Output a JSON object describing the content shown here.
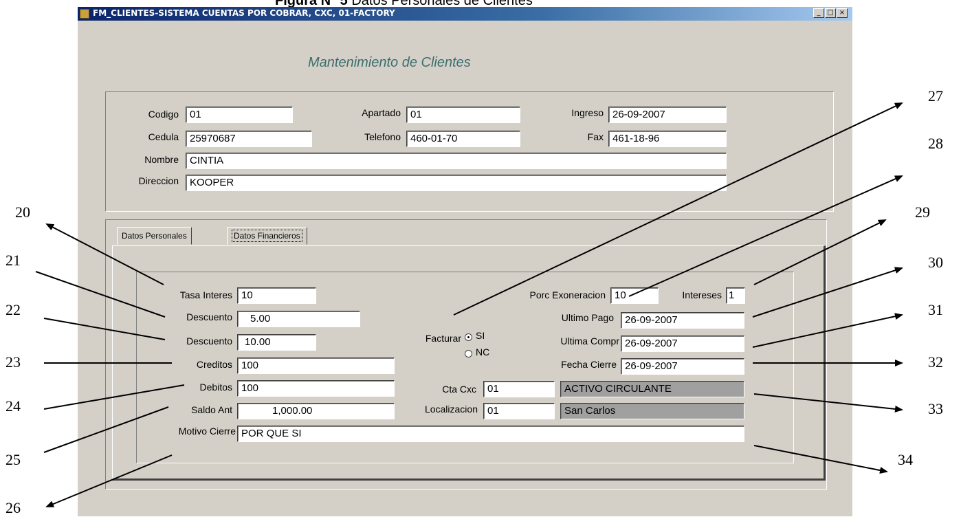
{
  "figure_caption": {
    "bold": "Figura N° 5",
    "rest": " Datos Personales de Clientes"
  },
  "window": {
    "title": "FM_CLIENTES-SISTEMA CUENTAS POR COBRAR, CXC, 01-FACTORY",
    "minimize_glyph": "_",
    "maximize_glyph": "□",
    "close_glyph": "×"
  },
  "form_title": "Mantenimiento de Clientes",
  "header": {
    "codigo": {
      "label": "Codigo",
      "value": "01"
    },
    "apartado": {
      "label": "Apartado",
      "value": "01"
    },
    "ingreso": {
      "label": "Ingreso",
      "value": "26-09-2007"
    },
    "cedula": {
      "label": "Cedula",
      "value": "25970687"
    },
    "telefono": {
      "label": "Telefono",
      "value": "460-01-70"
    },
    "fax": {
      "label": "Fax",
      "value": "461-18-96"
    },
    "nombre": {
      "label": "Nombre",
      "value": "CINTIA"
    },
    "direccion": {
      "label": "Direccion",
      "value": "KOOPER"
    }
  },
  "tabs": [
    {
      "label": "Datos Personales",
      "active": false
    },
    {
      "label": "Datos Financieros",
      "active": true
    }
  ],
  "financial": {
    "tasa_interes": {
      "label": "Tasa Interes",
      "value": "10"
    },
    "descuento1": {
      "label": "Descuento",
      "value": "5.00"
    },
    "descuento2": {
      "label": "Descuento",
      "value": "10.00"
    },
    "creditos": {
      "label": "Creditos",
      "value": "100"
    },
    "debitos": {
      "label": "Debitos",
      "value": "100"
    },
    "saldo_ant": {
      "label": "Saldo Ant",
      "value": "1,000.00"
    },
    "motivo_cierre": {
      "label": "Motivo Cierre",
      "value": "POR QUE SI"
    },
    "facturar": {
      "label": "Facturar",
      "options": [
        "SI",
        "NC"
      ],
      "selected": "SI"
    },
    "porc_exoneracion": {
      "label": "Porc Exoneracion",
      "value": "10"
    },
    "intereses": {
      "label": "Intereses",
      "value": "1"
    },
    "ultimo_pago": {
      "label": "Ultimo Pago",
      "value": "26-09-2007"
    },
    "ultima_compra": {
      "label": "Ultima Compr",
      "value": "26-09-2007"
    },
    "fecha_cierre": {
      "label": "Fecha Cierre",
      "value": "26-09-2007"
    },
    "cta_cxc": {
      "label": "Cta Cxc",
      "value": "01",
      "description": "ACTIVO CIRCULANTE"
    },
    "localizacion": {
      "label": "Localizacion",
      "value": "01",
      "description": "San Carlos"
    }
  },
  "callouts": [
    "20",
    "21",
    "22",
    "23",
    "24",
    "25",
    "26",
    "27",
    "28",
    "29",
    "30",
    "31",
    "32",
    "33",
    "34"
  ]
}
